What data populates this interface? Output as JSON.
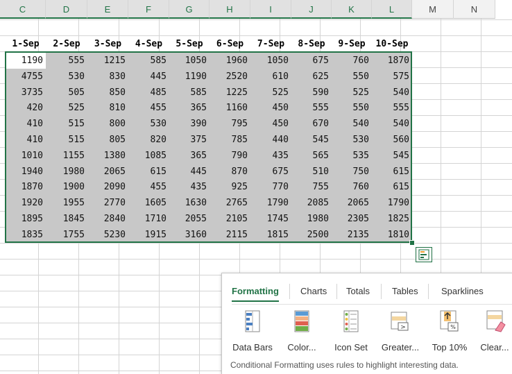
{
  "columns": [
    "C",
    "D",
    "E",
    "F",
    "G",
    "H",
    "I",
    "J",
    "K",
    "L",
    "M",
    "N"
  ],
  "headers": [
    "1-Sep",
    "2-Sep",
    "3-Sep",
    "4-Sep",
    "5-Sep",
    "6-Sep",
    "7-Sep",
    "8-Sep",
    "9-Sep",
    "10-Sep"
  ],
  "rows": [
    [
      "1190",
      "555",
      "1215",
      "585",
      "1050",
      "1960",
      "1050",
      "675",
      "760",
      "1870"
    ],
    [
      "4755",
      "530",
      "830",
      "445",
      "1190",
      "2520",
      "610",
      "625",
      "550",
      "575"
    ],
    [
      "3735",
      "505",
      "850",
      "485",
      "585",
      "1225",
      "525",
      "590",
      "525",
      "540"
    ],
    [
      "420",
      "525",
      "810",
      "455",
      "365",
      "1160",
      "450",
      "555",
      "550",
      "555"
    ],
    [
      "410",
      "515",
      "800",
      "530",
      "390",
      "795",
      "450",
      "670",
      "540",
      "540"
    ],
    [
      "410",
      "515",
      "805",
      "820",
      "375",
      "785",
      "440",
      "545",
      "530",
      "560"
    ],
    [
      "1010",
      "1155",
      "1380",
      "1085",
      "365",
      "790",
      "435",
      "565",
      "535",
      "545"
    ],
    [
      "1940",
      "1980",
      "2065",
      "615",
      "445",
      "870",
      "675",
      "510",
      "750",
      "615"
    ],
    [
      "1870",
      "1900",
      "2090",
      "455",
      "435",
      "925",
      "770",
      "755",
      "760",
      "615"
    ],
    [
      "1920",
      "1955",
      "2770",
      "1605",
      "1630",
      "2765",
      "1790",
      "2085",
      "2065",
      "1790"
    ],
    [
      "1895",
      "1845",
      "2840",
      "1710",
      "2055",
      "2105",
      "1745",
      "1980",
      "2305",
      "1825"
    ],
    [
      "1835",
      "1755",
      "5230",
      "1915",
      "3160",
      "2115",
      "1815",
      "2500",
      "2135",
      "1810"
    ]
  ],
  "quick_analysis": {
    "tabs": [
      {
        "label": "Formatting",
        "active": true
      },
      {
        "label": "Charts",
        "active": false
      },
      {
        "label": "Totals",
        "active": false
      },
      {
        "label": "Tables",
        "active": false
      },
      {
        "label": "Sparklines",
        "active": false
      }
    ],
    "tools": [
      {
        "label": "Data Bars",
        "icon": "data-bars-icon"
      },
      {
        "label": "Color...",
        "icon": "color-scale-icon"
      },
      {
        "label": "Icon Set",
        "icon": "icon-set-icon"
      },
      {
        "label": "Greater...",
        "icon": "greater-than-icon"
      },
      {
        "label": "Top 10%",
        "icon": "top-10-icon"
      },
      {
        "label": "Clear...",
        "icon": "clear-format-icon"
      }
    ],
    "description": "Conditional Formatting uses rules to highlight interesting data.",
    "accent": "#217346"
  }
}
